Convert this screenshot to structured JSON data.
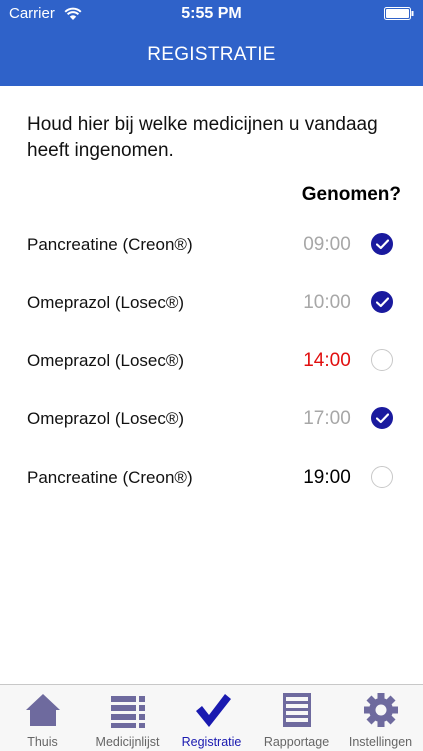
{
  "status_bar": {
    "carrier": "Carrier",
    "time": "5:55 PM"
  },
  "nav": {
    "title": "REGISTRATIE"
  },
  "intro_text": "Houd hier bij welke medicijnen u vandaag heeft ingenomen.",
  "column_header": "Genomen?",
  "medications": [
    {
      "name": "Pancreatine (Creon®)",
      "time": "09:00",
      "time_state": "past",
      "taken": true
    },
    {
      "name": "Omeprazol (Losec®)",
      "time": "10:00",
      "time_state": "past",
      "taken": true
    },
    {
      "name": "Omeprazol (Losec®)",
      "time": "14:00",
      "time_state": "late",
      "taken": false
    },
    {
      "name": "Omeprazol (Losec®)",
      "time": "17:00",
      "time_state": "past",
      "taken": true
    },
    {
      "name": "Pancreatine (Creon®)",
      "time": "19:00",
      "time_state": "upcoming",
      "taken": false
    }
  ],
  "tabs": [
    {
      "label": "Thuis",
      "icon": "house-icon",
      "active": false
    },
    {
      "label": "Medicijnlijst",
      "icon": "list-icon",
      "active": false
    },
    {
      "label": "Registratie",
      "icon": "checkmark-icon",
      "active": true
    },
    {
      "label": "Rapportage",
      "icon": "report-table-icon",
      "active": false
    },
    {
      "label": "Instellingen",
      "icon": "gear-icon",
      "active": false
    }
  ],
  "colors": {
    "header": "#2f62c9",
    "accent": "#1a1a9e",
    "late": "#e10f0f",
    "muted": "#a7a7a7",
    "tab_icon": "#6e6a9e"
  }
}
